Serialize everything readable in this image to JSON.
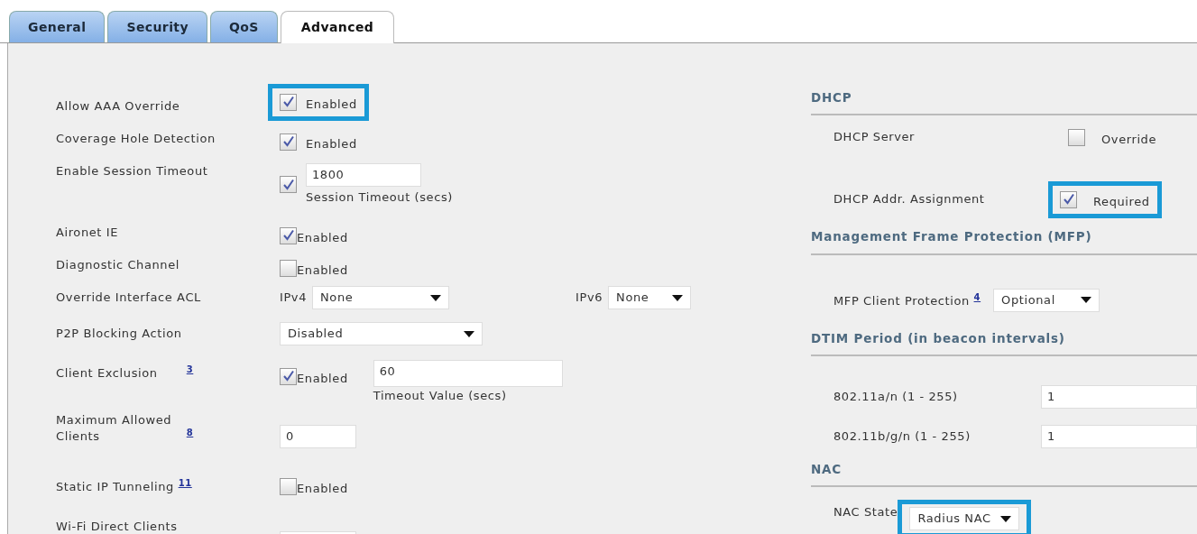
{
  "tabs": [
    {
      "label": "General",
      "selected": false
    },
    {
      "label": "Security",
      "selected": false
    },
    {
      "label": "QoS",
      "selected": false
    },
    {
      "label": "Advanced",
      "selected": true
    }
  ],
  "left_rows": [
    {
      "kind": "checkbox",
      "label": "Allow AAA Override",
      "checked": true,
      "option": "Enabled",
      "highlighted": true
    },
    {
      "kind": "checkbox",
      "label": "Coverage Hole Detection",
      "checked": true,
      "option": "Enabled"
    },
    {
      "kind": "timeout",
      "label": "Enable Session Timeout",
      "checked": true,
      "value": "1800",
      "caption": "Session Timeout (secs)"
    },
    {
      "kind": "checkbox",
      "label": "Aironet IE",
      "checked": true,
      "option": "Enabled"
    },
    {
      "kind": "checkbox",
      "label": "Diagnostic Channel",
      "checked": false,
      "option": "Enabled"
    },
    {
      "kind": "acl",
      "label": "Override Interface ACL",
      "selects": [
        {
          "prefix": "IPv4",
          "value": "None"
        },
        {
          "prefix": "IPv6",
          "value": "None"
        }
      ]
    },
    {
      "kind": "select",
      "label": "P2P Blocking Action",
      "value": "Disabled"
    },
    {
      "kind": "exclusion",
      "label": "Client Exclusion",
      "footnote": "3",
      "checked": true,
      "option": "Enabled",
      "value": "60",
      "caption": "Timeout Value (secs)"
    },
    {
      "kind": "input",
      "label": "Maximum Allowed Clients",
      "footnote": "8",
      "value": "0"
    },
    {
      "kind": "checkbox",
      "label": "Static IP Tunneling",
      "footnote": "11",
      "checked": false,
      "option": "Enabled"
    },
    {
      "kind": "input",
      "label": "Wi-Fi Direct Clients"
    }
  ],
  "right_sections": [
    {
      "title": "DHCP",
      "rows": [
        {
          "kind": "checkbox",
          "label": "DHCP Server",
          "checked": false,
          "option": "Override"
        },
        {
          "kind": "checkbox",
          "label": "DHCP Addr. Assignment",
          "checked": true,
          "option": "Required",
          "highlighted": true
        }
      ]
    },
    {
      "title": "Management Frame Protection (MFP)",
      "rows": [
        {
          "kind": "select",
          "label": "MFP Client Protection",
          "footnote": "4",
          "value": "Optional"
        }
      ]
    },
    {
      "title": "DTIM Period (in beacon intervals)",
      "rows": [
        {
          "kind": "input",
          "label": "802.11a/n (1 - 255)",
          "value": "1"
        },
        {
          "kind": "input",
          "label": "802.11b/g/n (1 - 255)",
          "value": "1"
        }
      ]
    },
    {
      "title": "NAC",
      "rows": [
        {
          "kind": "select",
          "label": "NAC State",
          "value": "Radius NAC",
          "highlighted": true
        }
      ]
    }
  ]
}
